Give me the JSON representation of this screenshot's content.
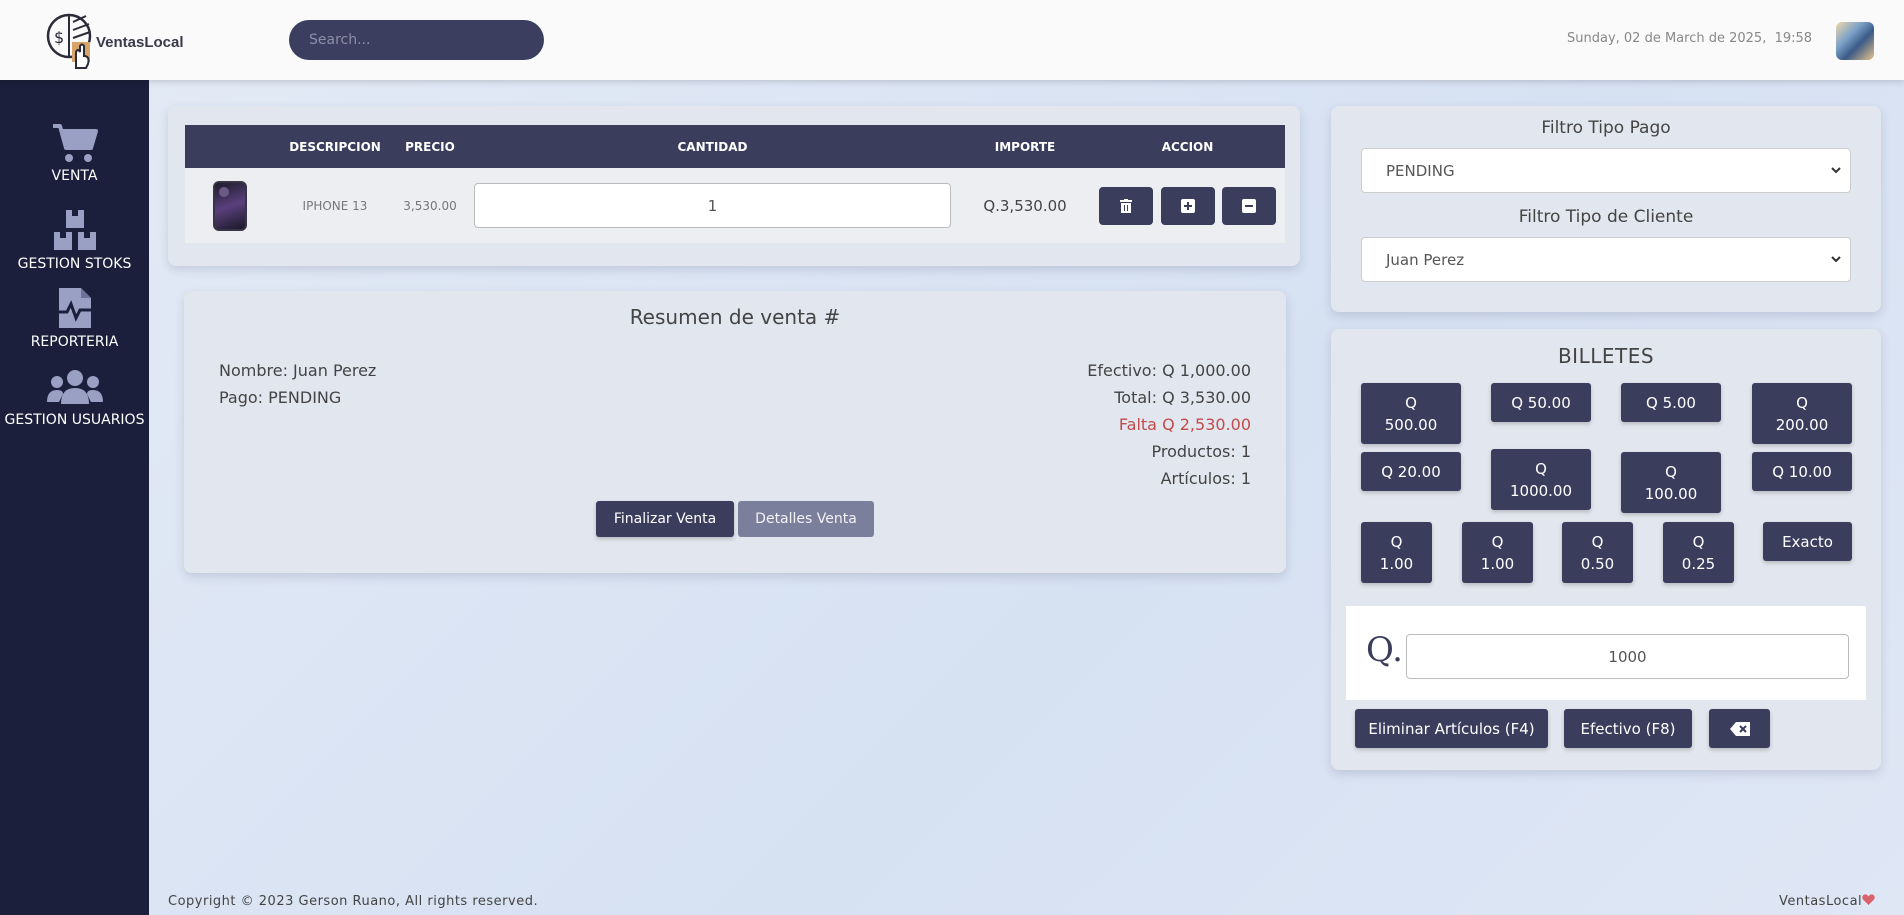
{
  "app": {
    "name": "VentasLocal"
  },
  "header": {
    "search_placeholder": "Search...",
    "date": "Sunday, 02 de March de 2025,",
    "time": "19:58"
  },
  "sidebar": {
    "items": [
      {
        "label": "VENTA",
        "icon": "cart-icon"
      },
      {
        "label": "GESTION STOKS",
        "icon": "boxes-icon"
      },
      {
        "label": "REPORTERIA",
        "icon": "report-icon"
      },
      {
        "label": "GESTION USUARIOS",
        "icon": "users-icon"
      }
    ]
  },
  "cart_table": {
    "headers": [
      "",
      "DESCRIPCION",
      "PRECIO",
      "CANTIDAD",
      "IMPORTE",
      "ACCION"
    ],
    "rows": [
      {
        "descripcion": "IPHONE 13",
        "precio": "3,530.00",
        "cantidad": "1",
        "importe": "Q.3,530.00"
      }
    ]
  },
  "summary": {
    "title": "Resumen de venta #",
    "nombre": "Nombre: Juan Perez",
    "pago": "Pago: PENDING",
    "efectivo": "Efectivo: Q 1,000.00",
    "total": "Total: Q 3,530.00",
    "falta": "Falta Q 2,530.00",
    "productos": "Productos: 1",
    "articulos": "Artículos: 1",
    "finalize_label": "Finalizar Venta",
    "details_label": "Detalles Venta"
  },
  "filters": {
    "tipo_pago_label": "Filtro Tipo Pago",
    "tipo_pago_value": "PENDING",
    "tipo_cliente_label": "Filtro Tipo de Cliente",
    "tipo_cliente_value": "Juan Perez"
  },
  "billetes": {
    "title": "BILLETES",
    "buttons": [
      {
        "line1": "Q",
        "line2": "500.00"
      },
      {
        "line1": "Q 50.00",
        "line2": ""
      },
      {
        "line1": "Q 5.00",
        "line2": ""
      },
      {
        "line1": "Q",
        "line2": "200.00"
      },
      {
        "line1": "Q 20.00",
        "line2": ""
      },
      {
        "line1": "Q",
        "line2": "1000.00"
      },
      {
        "line1": "Q",
        "line2": "100.00"
      },
      {
        "line1": "Q 10.00",
        "line2": ""
      },
      {
        "line1": "Q",
        "line2": "1.00"
      },
      {
        "line1": "Q",
        "line2": "1.00"
      },
      {
        "line1": "Q",
        "line2": "0.50"
      },
      {
        "line1": "Q",
        "line2": "0.25"
      },
      {
        "line1": "Exacto",
        "line2": ""
      }
    ]
  },
  "cash": {
    "prefix": "Q.",
    "value": "1000",
    "delete_label": "Eliminar Artículos (F4)",
    "efectivo_label": "Efectivo (F8)"
  },
  "footer": {
    "copyright": "Copyright © 2023 Gerson Ruano, All rights reserved.",
    "brand": "VentasLocal"
  },
  "colors": {
    "sidebar": "#1b1f3b",
    "primary": "#3a3d5c",
    "danger_text": "#c24b4b",
    "background": "#dfe7f5"
  }
}
